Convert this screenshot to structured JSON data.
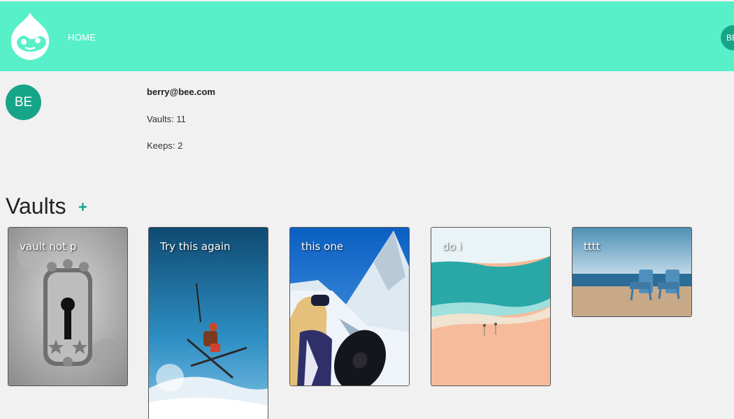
{
  "nav": {
    "home_label": "HOME",
    "avatar_initials": "BE"
  },
  "colors": {
    "header_bg": "#57f0c8",
    "accent": "#17a589",
    "page_bg": "#f1f1f1"
  },
  "profile": {
    "initials": "BE",
    "email": "berry@bee.com",
    "vaults_text": "Vaults: 11",
    "keeps_text": "Keeps: 2"
  },
  "vaults_section": {
    "title": "Vaults",
    "add_icon": "+"
  },
  "vaults": [
    {
      "name": "vault not p",
      "image": "keyhole-lock"
    },
    {
      "name": "Try this again",
      "image": "skier-jump"
    },
    {
      "name": "this one",
      "image": "snowboarder-mountain"
    },
    {
      "name": "do i",
      "image": "beach-aerial"
    },
    {
      "name": "tttt",
      "image": "beach-chairs"
    }
  ]
}
